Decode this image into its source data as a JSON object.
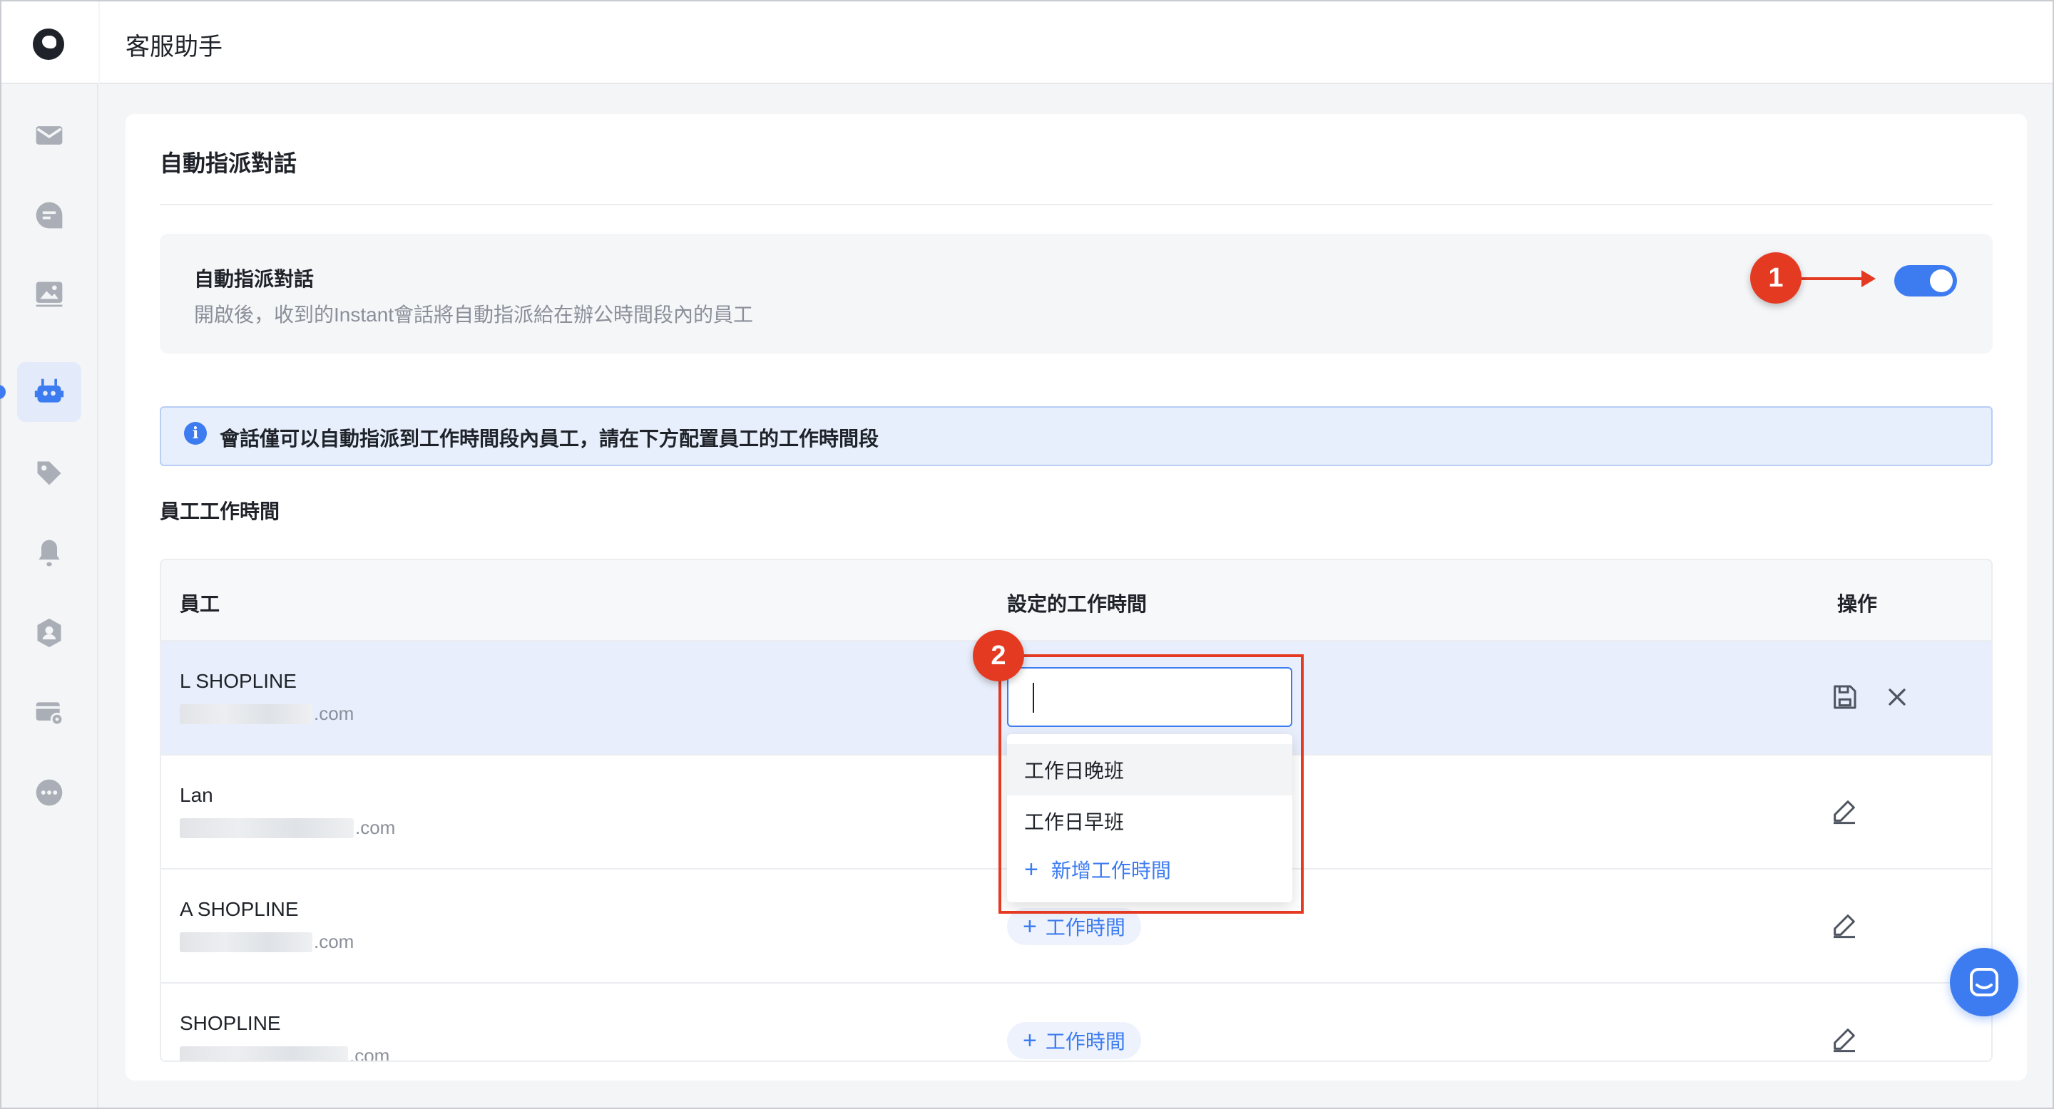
{
  "app": {
    "title": "客服助手"
  },
  "sidebar": {
    "items": [
      {
        "icon": "mail-icon"
      },
      {
        "icon": "chat-icon"
      },
      {
        "icon": "image-icon"
      },
      {
        "icon": "robot-icon",
        "active": true
      },
      {
        "icon": "tag-icon"
      },
      {
        "icon": "bell-icon"
      },
      {
        "icon": "user-shield-icon"
      },
      {
        "icon": "card-settings-icon"
      },
      {
        "icon": "more-icon"
      }
    ]
  },
  "page": {
    "section_title": "自動指派對話",
    "setting": {
      "title": "自動指派對話",
      "description": "開啟後，收到的Instant會話將自動指派給在辦公時間段內的員工",
      "enabled": true
    },
    "info_message": "會話僅可以自動指派到工作時間段內員工，請在下方配置員工的工作時間段",
    "subsection_title": "員工工作時間"
  },
  "table": {
    "columns": [
      "員工",
      "設定的工作時間",
      "操作"
    ],
    "rows": [
      {
        "name": "L SHOPLINE",
        "email_suffix": ".com",
        "editing": true
      },
      {
        "name": "Lan",
        "email_suffix": ".com"
      },
      {
        "name": "A SHOPLINE",
        "email_suffix": ".com",
        "action": "工作時間"
      },
      {
        "name": "SHOPLINE",
        "email_suffix": ".com",
        "action": "工作時間"
      }
    ]
  },
  "dropdown": {
    "input_value": "",
    "options": [
      "工作日晚班",
      "工作日早班"
    ],
    "add_label": "新增工作時間"
  },
  "annotations": {
    "marker1": "1",
    "marker2": "2"
  },
  "colors": {
    "accent": "#3d7cf0",
    "annotation": "#e53a22"
  }
}
